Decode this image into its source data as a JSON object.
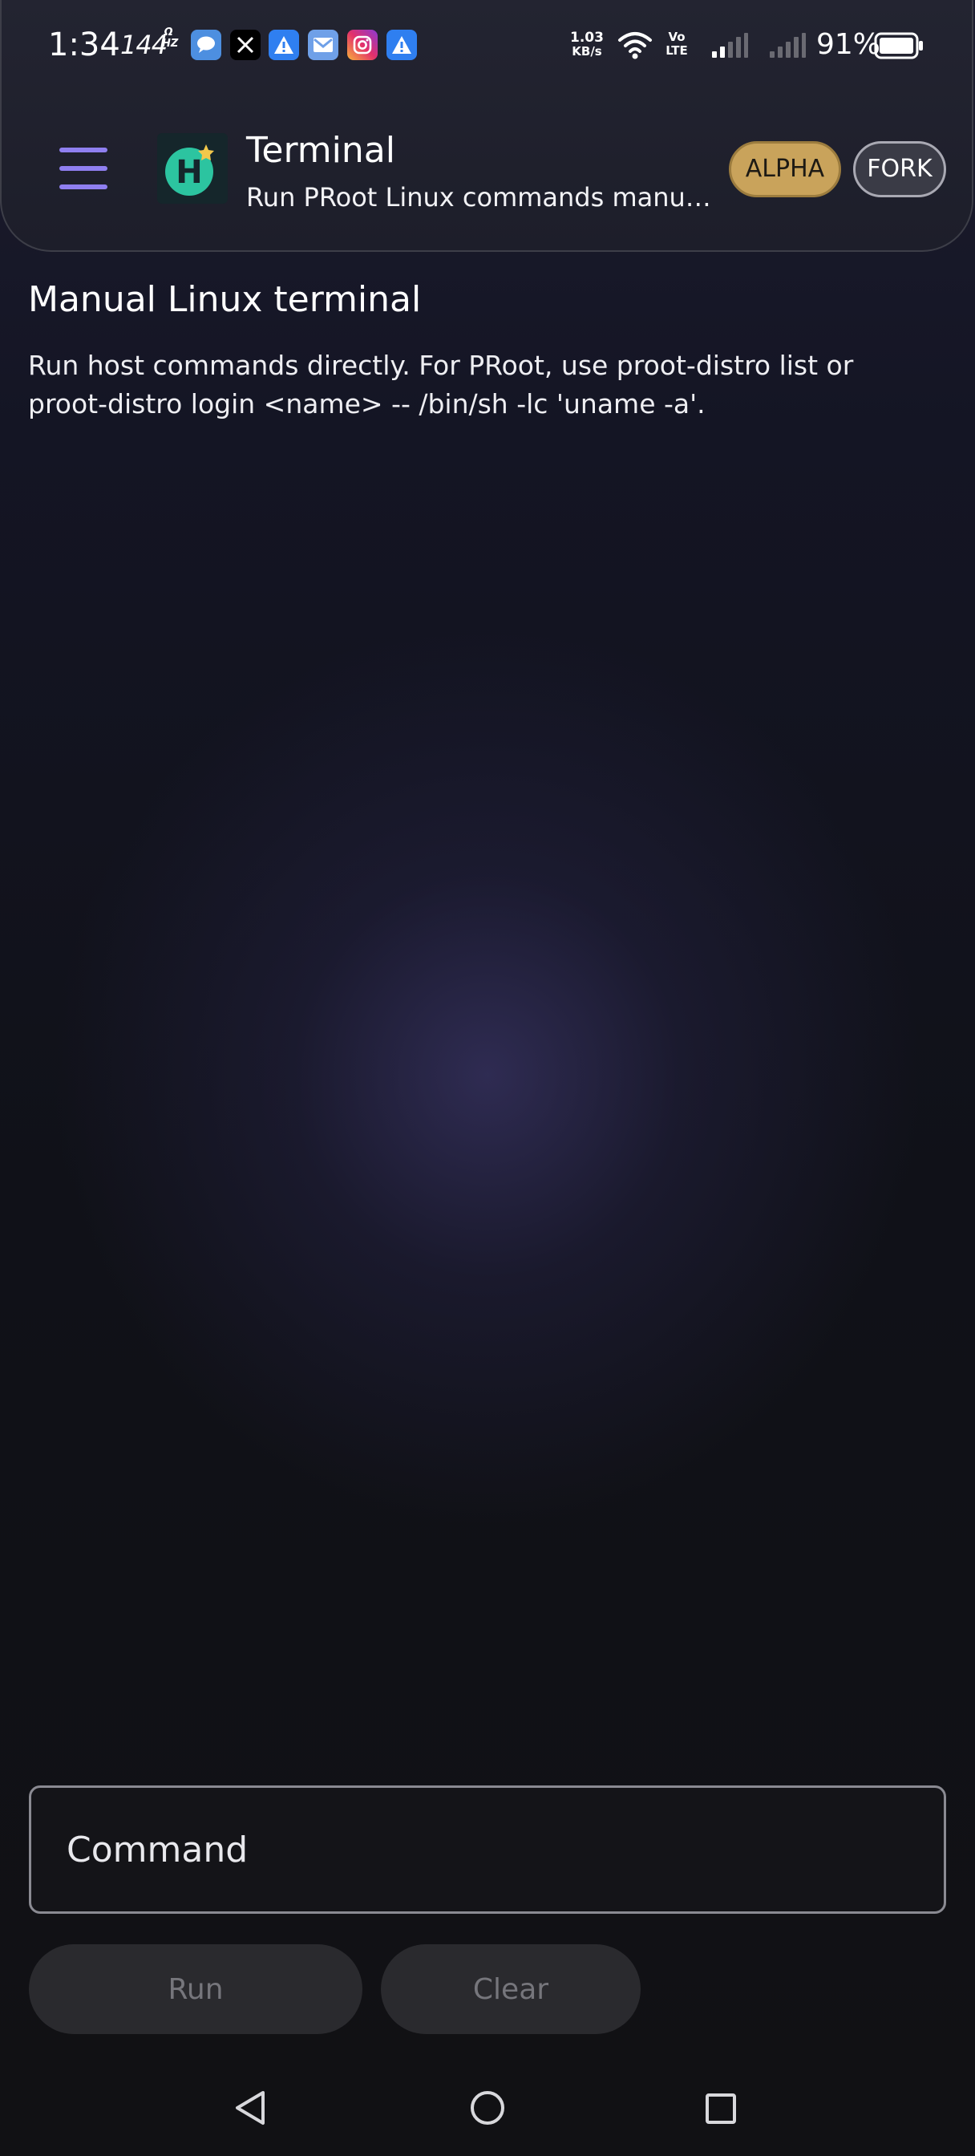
{
  "status_bar": {
    "time": "1:34",
    "refresh_rate": "144",
    "refresh_rate_unit": "HZ",
    "refresh_rate_sup": "Ω",
    "notifications": [
      {
        "icon": "chat-bubble-icon",
        "color": "#4d8fe0"
      },
      {
        "icon": "x-app-icon",
        "color": "#000000"
      },
      {
        "icon": "alert-triangle-icon",
        "color": "#2f7ff0"
      },
      {
        "icon": "mail-icon",
        "color": "#6fa0e8"
      },
      {
        "icon": "instagram-icon",
        "color": "#d62f7e"
      },
      {
        "icon": "alert-triangle-icon",
        "color": "#2f7ff0"
      }
    ],
    "net_speed_value": "1.03",
    "net_speed_unit": "KB/s",
    "volte_top": "Vo",
    "volte_bottom": "LTE",
    "battery": "91%"
  },
  "header": {
    "logo_letter": "H",
    "title": "Terminal",
    "subtitle": "Run PRoot Linux commands manually inside the sandbox",
    "badge_alpha": "ALPHA",
    "badge_fork": "FORK"
  },
  "content": {
    "section_title": "Manual Linux terminal",
    "description": "Run host commands directly. For PRoot, use proot-distro list or proot-distro login <name> -- /bin/sh -lc 'uname -a'."
  },
  "command": {
    "placeholder": "Command",
    "value": ""
  },
  "buttons": {
    "run": "Run",
    "clear": "Clear"
  },
  "colors": {
    "accent": "#8f7ff0",
    "badge_alpha": "#c9a35b",
    "logo_teal": "#2cc4a0",
    "logo_star": "#f2c84b"
  }
}
